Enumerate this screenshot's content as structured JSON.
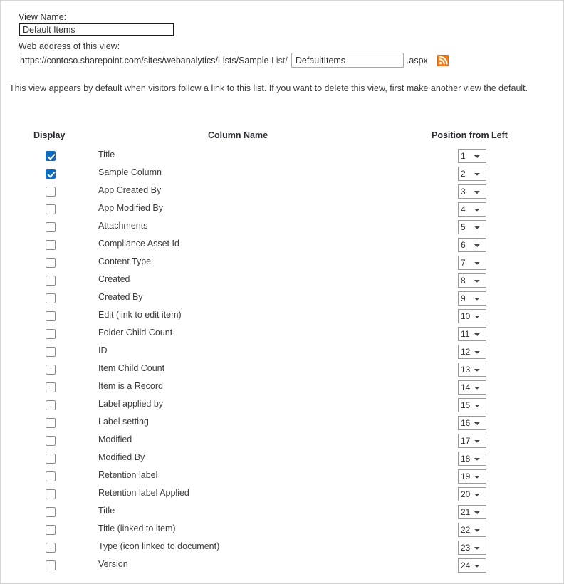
{
  "form": {
    "view_name_label": "View Name:",
    "view_name_value": "Default Items",
    "view_name_placeholder": "",
    "web_address_label": "Web address of this view:",
    "url_prefix": "https://contoso.sharepoint.com/sites/webanalytics/Lists/Sample",
    "url_list_segment": " List/",
    "url_value": "DefaultItems",
    "url_placeholder": "",
    "url_suffix": ".aspx",
    "rss_icon": "rss-feed-icon",
    "default_note": "This view appears by default when visitors follow a link to this list. If you want to delete this view, first make another view the default."
  },
  "columns_table": {
    "headers": {
      "display": "Display",
      "column_name": "Column Name",
      "position": "Position from Left"
    },
    "position_options": [
      "1",
      "2",
      "3",
      "4",
      "5",
      "6",
      "7",
      "8",
      "9",
      "10",
      "11",
      "12",
      "13",
      "14",
      "15",
      "16",
      "17",
      "18",
      "19",
      "20",
      "21",
      "22",
      "23",
      "24"
    ],
    "rows": [
      {
        "name": "Title",
        "checked": true,
        "position": "1"
      },
      {
        "name": "Sample Column",
        "checked": true,
        "position": "2"
      },
      {
        "name": "App Created By",
        "checked": false,
        "position": "3"
      },
      {
        "name": "App Modified By",
        "checked": false,
        "position": "4"
      },
      {
        "name": "Attachments",
        "checked": false,
        "position": "5"
      },
      {
        "name": "Compliance Asset Id",
        "checked": false,
        "position": "6"
      },
      {
        "name": "Content Type",
        "checked": false,
        "position": "7"
      },
      {
        "name": "Created",
        "checked": false,
        "position": "8"
      },
      {
        "name": "Created By",
        "checked": false,
        "position": "9"
      },
      {
        "name": "Edit (link to edit item)",
        "checked": false,
        "position": "10"
      },
      {
        "name": "Folder Child Count",
        "checked": false,
        "position": "11"
      },
      {
        "name": "ID",
        "checked": false,
        "position": "12"
      },
      {
        "name": "Item Child Count",
        "checked": false,
        "position": "13"
      },
      {
        "name": "Item is a Record",
        "checked": false,
        "position": "14"
      },
      {
        "name": "Label applied by",
        "checked": false,
        "position": "15"
      },
      {
        "name": "Label setting",
        "checked": false,
        "position": "16"
      },
      {
        "name": "Modified",
        "checked": false,
        "position": "17"
      },
      {
        "name": "Modified By",
        "checked": false,
        "position": "18"
      },
      {
        "name": "Retention label",
        "checked": false,
        "position": "19"
      },
      {
        "name": "Retention label Applied",
        "checked": false,
        "position": "20"
      },
      {
        "name": "Title",
        "checked": false,
        "position": "21"
      },
      {
        "name": "Title (linked to item)",
        "checked": false,
        "position": "22"
      },
      {
        "name": "Type (icon linked to document)",
        "checked": false,
        "position": "23"
      },
      {
        "name": "Version",
        "checked": false,
        "position": "24"
      }
    ]
  },
  "colors": {
    "checkbox_checked": "#0f6cbd",
    "rss_orange": "#f07d19",
    "page_border": "#d6d6d6",
    "text": "#333333"
  }
}
